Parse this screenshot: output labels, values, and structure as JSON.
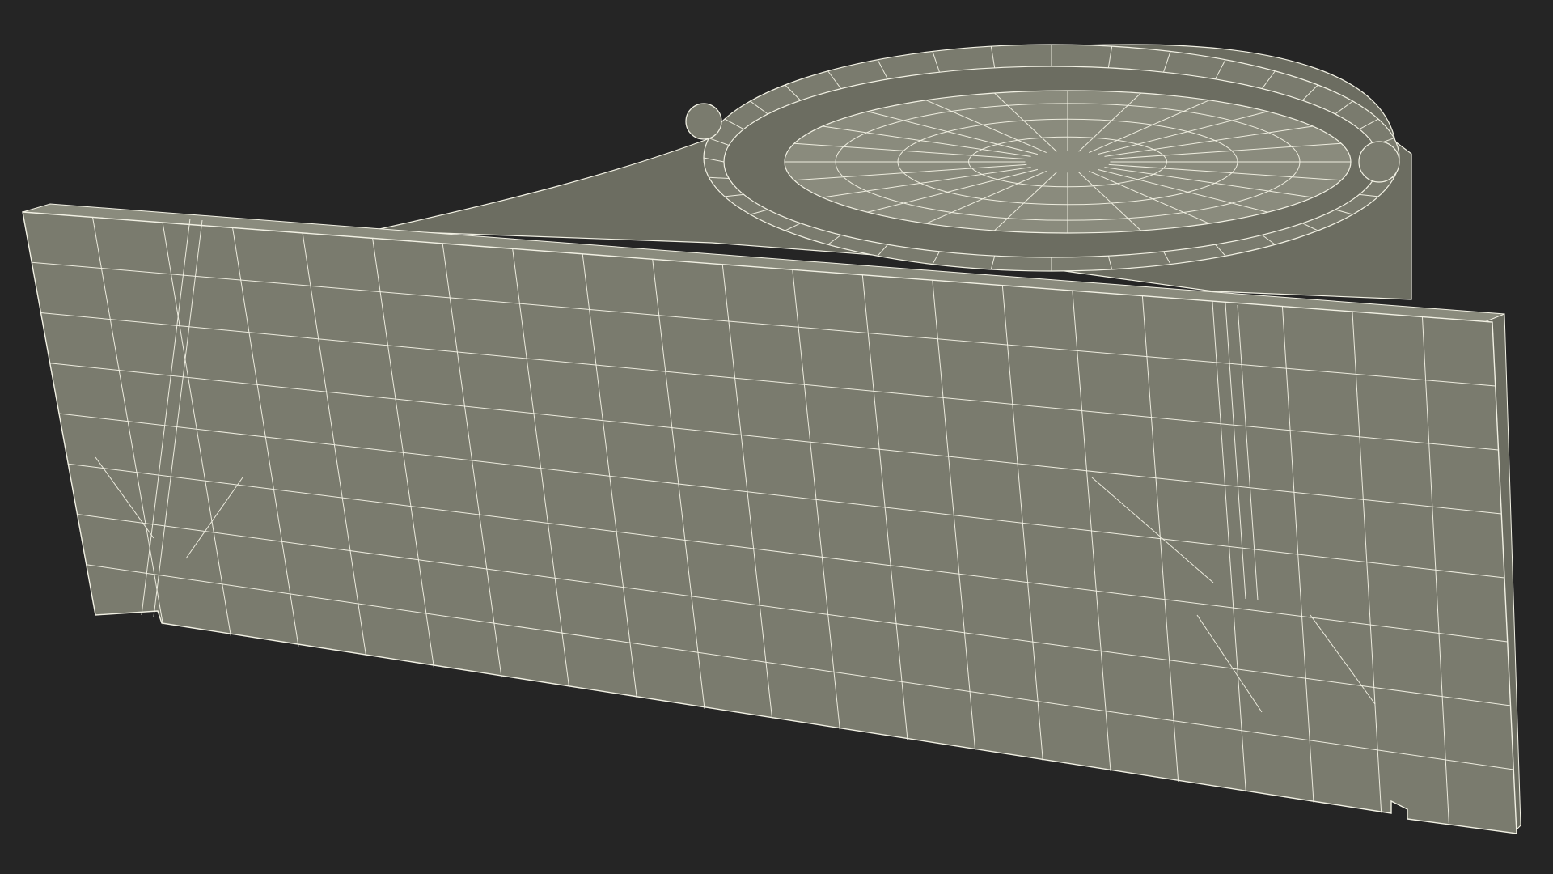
{
  "viewport": {
    "background_color": "#252525",
    "model": {
      "shape": "wireframe-bracket-with-oval-mount",
      "surface_color": "#7a7b6e",
      "surface_shadow_color": "#6c6d61",
      "top_color": "#8a8b7d",
      "wire_color": "#f2f1e4"
    }
  }
}
